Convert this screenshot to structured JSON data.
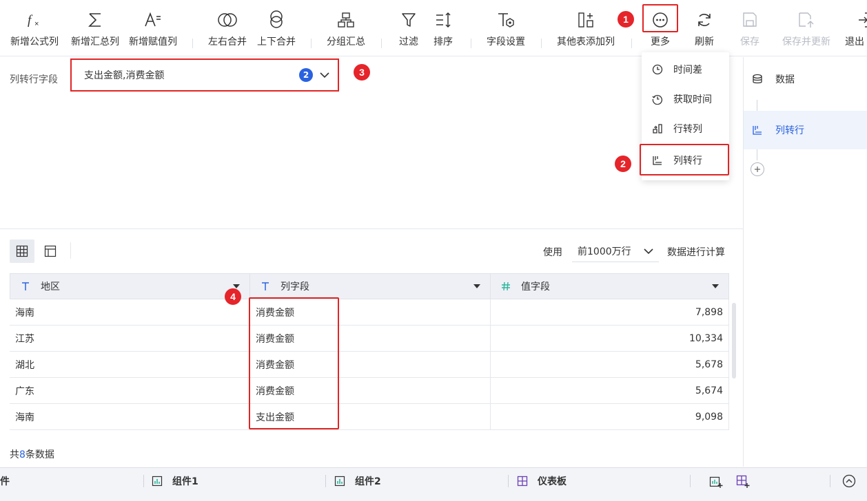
{
  "toolbar": {
    "items": [
      {
        "label": "新增公式列",
        "icon": "fx-icon"
      },
      {
        "label": "新增汇总列",
        "icon": "sigma-icon"
      },
      {
        "label": "新增赋值列",
        "icon": "assign-icon"
      },
      {
        "label": "左右合并",
        "icon": "merge-horizontal-icon"
      },
      {
        "label": "上下合并",
        "icon": "merge-vertical-icon"
      },
      {
        "label": "分组汇总",
        "icon": "group-icon"
      },
      {
        "label": "过滤",
        "icon": "filter-icon"
      },
      {
        "label": "排序",
        "icon": "sort-icon"
      },
      {
        "label": "字段设置",
        "icon": "field-settings-icon"
      },
      {
        "label": "其他表添加列",
        "icon": "add-column-icon"
      },
      {
        "label": "更多",
        "icon": "more-icon"
      },
      {
        "label": "刷新",
        "icon": "refresh-icon"
      },
      {
        "label": "保存",
        "icon": "save-icon",
        "disabled": true
      },
      {
        "label": "保存并更新",
        "icon": "save-update-icon",
        "disabled": true
      },
      {
        "label": "退出",
        "icon": "exit-icon"
      }
    ]
  },
  "badges": {
    "b1": "1",
    "b2": "2",
    "b3": "3",
    "b4": "4"
  },
  "config": {
    "label": "列转行字段",
    "value": "支出金额,消费金额",
    "count": "2"
  },
  "more_menu": {
    "items": [
      {
        "label": "时间差",
        "icon": "clock-icon"
      },
      {
        "label": "获取时间",
        "icon": "clock-history-icon"
      },
      {
        "label": "行转列",
        "icon": "row-to-column-icon"
      },
      {
        "label": "列转行",
        "icon": "column-to-row-icon"
      }
    ]
  },
  "right_panel": {
    "steps": [
      {
        "label": "数据",
        "icon": "database-icon"
      },
      {
        "label": "列转行",
        "icon": "column-to-row-icon"
      }
    ]
  },
  "preview": {
    "use_label": "使用",
    "limit": "前1000万行",
    "calc_label": "数据进行计算",
    "total_prefix": "共",
    "total_count": "8",
    "total_suffix": "条数据"
  },
  "table": {
    "columns": [
      {
        "name": "地区",
        "type": "text"
      },
      {
        "name": "列字段",
        "type": "text"
      },
      {
        "name": "值字段",
        "type": "number"
      }
    ],
    "rows": [
      [
        "海南",
        "消费金额",
        "7,898"
      ],
      [
        "江苏",
        "消费金额",
        "10,334"
      ],
      [
        "湖北",
        "消费金额",
        "5,678"
      ],
      [
        "广东",
        "消费金额",
        "5,674"
      ],
      [
        "海南",
        "支出金额",
        "9,098"
      ]
    ]
  },
  "bottom_tabs": [
    {
      "label": "件"
    },
    {
      "label": "组件1",
      "icon": "chart-icon"
    },
    {
      "label": "组件2",
      "icon": "chart-icon"
    },
    {
      "label": "仪表板",
      "icon": "dashboard-icon"
    }
  ],
  "colors": {
    "accent": "#2a62e0",
    "highlight": "#e02424",
    "selected_bg": "#eef3fc"
  }
}
